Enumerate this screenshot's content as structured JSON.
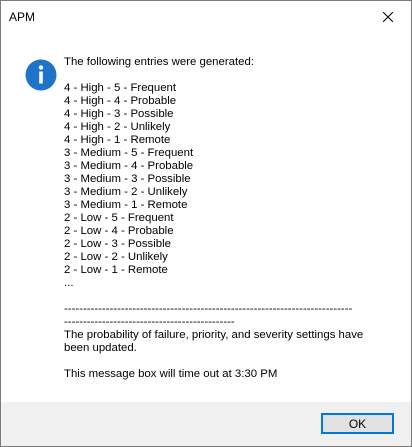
{
  "window": {
    "title": "APM"
  },
  "message": {
    "lines": [
      "The following entries were generated:",
      "",
      "4 - High - 5 - Frequent",
      "4 - High - 4 - Probable",
      "4 - High - 3 - Possible",
      "4 - High - 2 - Unlikely",
      "4 - High - 1 - Remote",
      "3 - Medium - 5 - Frequent",
      "3 - Medium - 4 - Probable",
      "3 - Medium - 3 - Possible",
      "3 - Medium - 2 - Unlikely",
      "3 - Medium - 1 - Remote",
      "2 - Low - 5 - Frequent",
      "2 - Low - 4 - Probable",
      "2 - Low - 3 - Possible",
      "2 - Low - 2 - Unlikely",
      "2 - Low - 1 - Remote",
      "...",
      "",
      "----------------------------------------------------------------------------",
      "---------------------------------------------",
      "The probability of failure, priority, and severity settings have",
      "been updated.",
      "",
      "This message box will time out at 3:30 PM"
    ]
  },
  "buttons": {
    "ok_label": "OK"
  },
  "icons": {
    "info": "information-icon",
    "close": "close-icon"
  },
  "colors": {
    "info_icon": "#1e74c8",
    "footer_bg": "#f0f0f0",
    "button_border": "#0078d7"
  }
}
